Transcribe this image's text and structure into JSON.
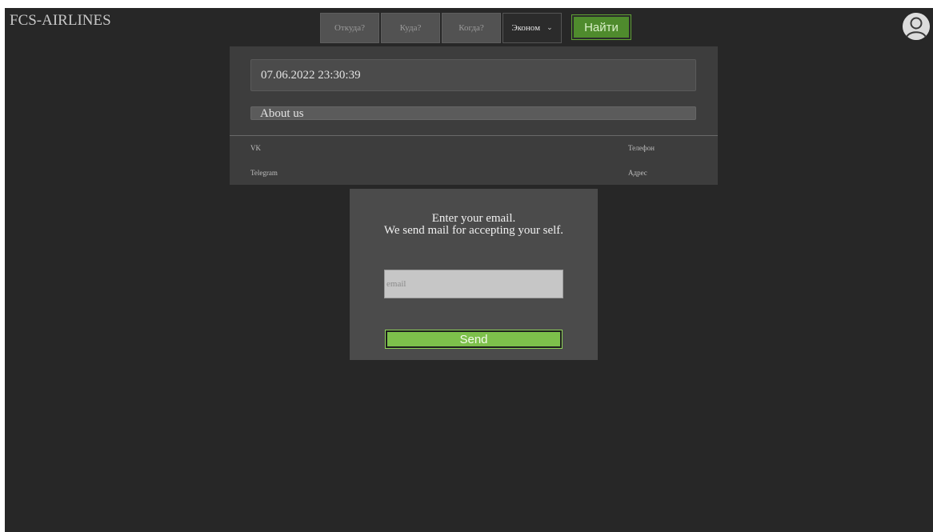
{
  "header": {
    "logo": "FCS-AIRLINES",
    "search": {
      "from_label": "Откуда?",
      "to_label": "Куда?",
      "when_label": "Когда?",
      "class_selected": "Эконом",
      "find_label": "Найти"
    },
    "profile_icon": "user-avatar-icon"
  },
  "content": {
    "datetime": "07.06.2022 23:30:39",
    "about_label": "About us"
  },
  "footer": {
    "vk": "VK",
    "telegram": "Telegram",
    "phone": "Телефон",
    "address": "Адрес"
  },
  "modal": {
    "line1": "Enter your email.",
    "line2": "We send mail for accepting your self.",
    "email_placeholder": "email",
    "send_label": "Send"
  },
  "colors": {
    "background": "#272727",
    "accent_green": "#7dc04b",
    "find_green": "#4f8b2d"
  }
}
